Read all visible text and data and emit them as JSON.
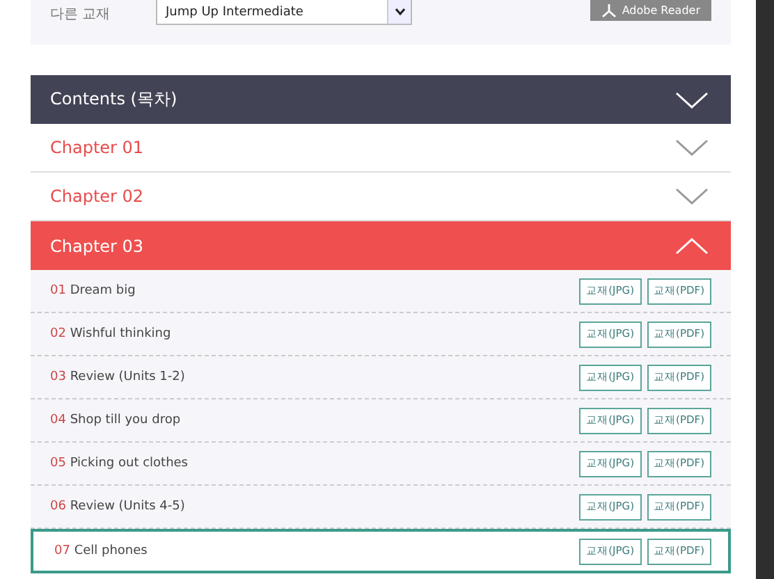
{
  "top_bar": {
    "label": "다른 교재",
    "select_value": "Jump Up Intermediate",
    "reader_button": "Adobe Reader"
  },
  "contents_header": {
    "title": "Contents (목차)",
    "expanded": false
  },
  "chapters": [
    {
      "title": "Chapter 01",
      "expanded": false
    },
    {
      "title": "Chapter 02",
      "expanded": false
    },
    {
      "title": "Chapter 03",
      "expanded": true,
      "units": [
        {
          "number": "01",
          "title": "Dream big",
          "selected": false,
          "buttons": [
            "교재(JPG)",
            "교재(PDF)"
          ]
        },
        {
          "number": "02",
          "title": "Wishful thinking",
          "selected": false,
          "buttons": [
            "교재(JPG)",
            "교재(PDF)"
          ]
        },
        {
          "number": "03",
          "title": "Review (Units 1-2)",
          "selected": false,
          "buttons": [
            "교재(JPG)",
            "교재(PDF)"
          ]
        },
        {
          "number": "04",
          "title": "Shop till you drop",
          "selected": false,
          "buttons": [
            "교재(JPG)",
            "교재(PDF)"
          ]
        },
        {
          "number": "05",
          "title": "Picking out clothes",
          "selected": false,
          "buttons": [
            "교재(JPG)",
            "교재(PDF)"
          ]
        },
        {
          "number": "06",
          "title": "Review (Units 4-5)",
          "selected": false,
          "buttons": [
            "교재(JPG)",
            "교재(PDF)"
          ]
        },
        {
          "number": "07",
          "title": "Cell phones",
          "selected": true,
          "buttons": [
            "교재(JPG)",
            "교재(PDF)"
          ]
        }
      ]
    }
  ]
}
